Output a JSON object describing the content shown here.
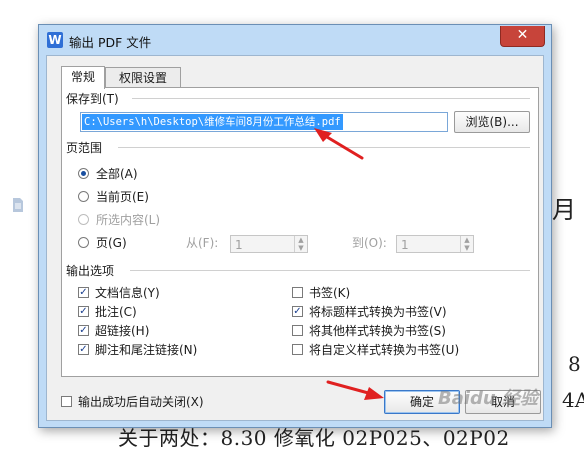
{
  "background": {
    "right_top_char": "月",
    "right_mid_char": "8",
    "right_mid2_text": "4A",
    "bottom_text": "关于两处：8.30 修氧化 02P025、02P02"
  },
  "dialog": {
    "title": "输出 PDF 文件",
    "close_glyph": "✕",
    "app_icon_letter": "W",
    "tabs": [
      {
        "label": "常规",
        "active": true
      },
      {
        "label": "权限设置",
        "active": false
      }
    ],
    "save_to": {
      "heading": "保存到(T)",
      "path_value": "C:\\Users\\h\\Desktop\\维修车间8月份工作总结.pdf",
      "browse_label": "浏览(B)..."
    },
    "page_range": {
      "heading": "页范围",
      "options": [
        {
          "label": "全部(A)",
          "selected": true,
          "enabled": true
        },
        {
          "label": "当前页(E)",
          "selected": false,
          "enabled": true
        },
        {
          "label": "所选内容(L)",
          "selected": false,
          "enabled": false
        },
        {
          "label": "页(G)",
          "selected": false,
          "enabled": true
        }
      ],
      "from_label": "从(F):",
      "from_value": "1",
      "to_label": "到(O):",
      "to_value": "1"
    },
    "output_options": {
      "heading": "输出选项",
      "left": [
        {
          "label": "文档信息(Y)",
          "checked": true
        },
        {
          "label": "批注(C)",
          "checked": true
        },
        {
          "label": "超链接(H)",
          "checked": true
        },
        {
          "label": "脚注和尾注链接(N)",
          "checked": true
        }
      ],
      "right": [
        {
          "label": "书签(K)",
          "checked": false
        },
        {
          "label": "将标题样式转换为书签(V)",
          "checked": true
        },
        {
          "label": "将其他样式转换为书签(S)",
          "checked": false
        },
        {
          "label": "将自定义样式转换为书签(U)",
          "checked": false
        }
      ]
    },
    "auto_close": {
      "label": "输出成功后自动关闭(X)",
      "checked": false
    },
    "ok_label": "确定",
    "cancel_label": "取消"
  },
  "watermark": "Baidu 经验",
  "colors": {
    "accent": "#3399ff",
    "arrow": "#e02020",
    "frame": "#bfdbf6",
    "close": "#c7443a"
  }
}
